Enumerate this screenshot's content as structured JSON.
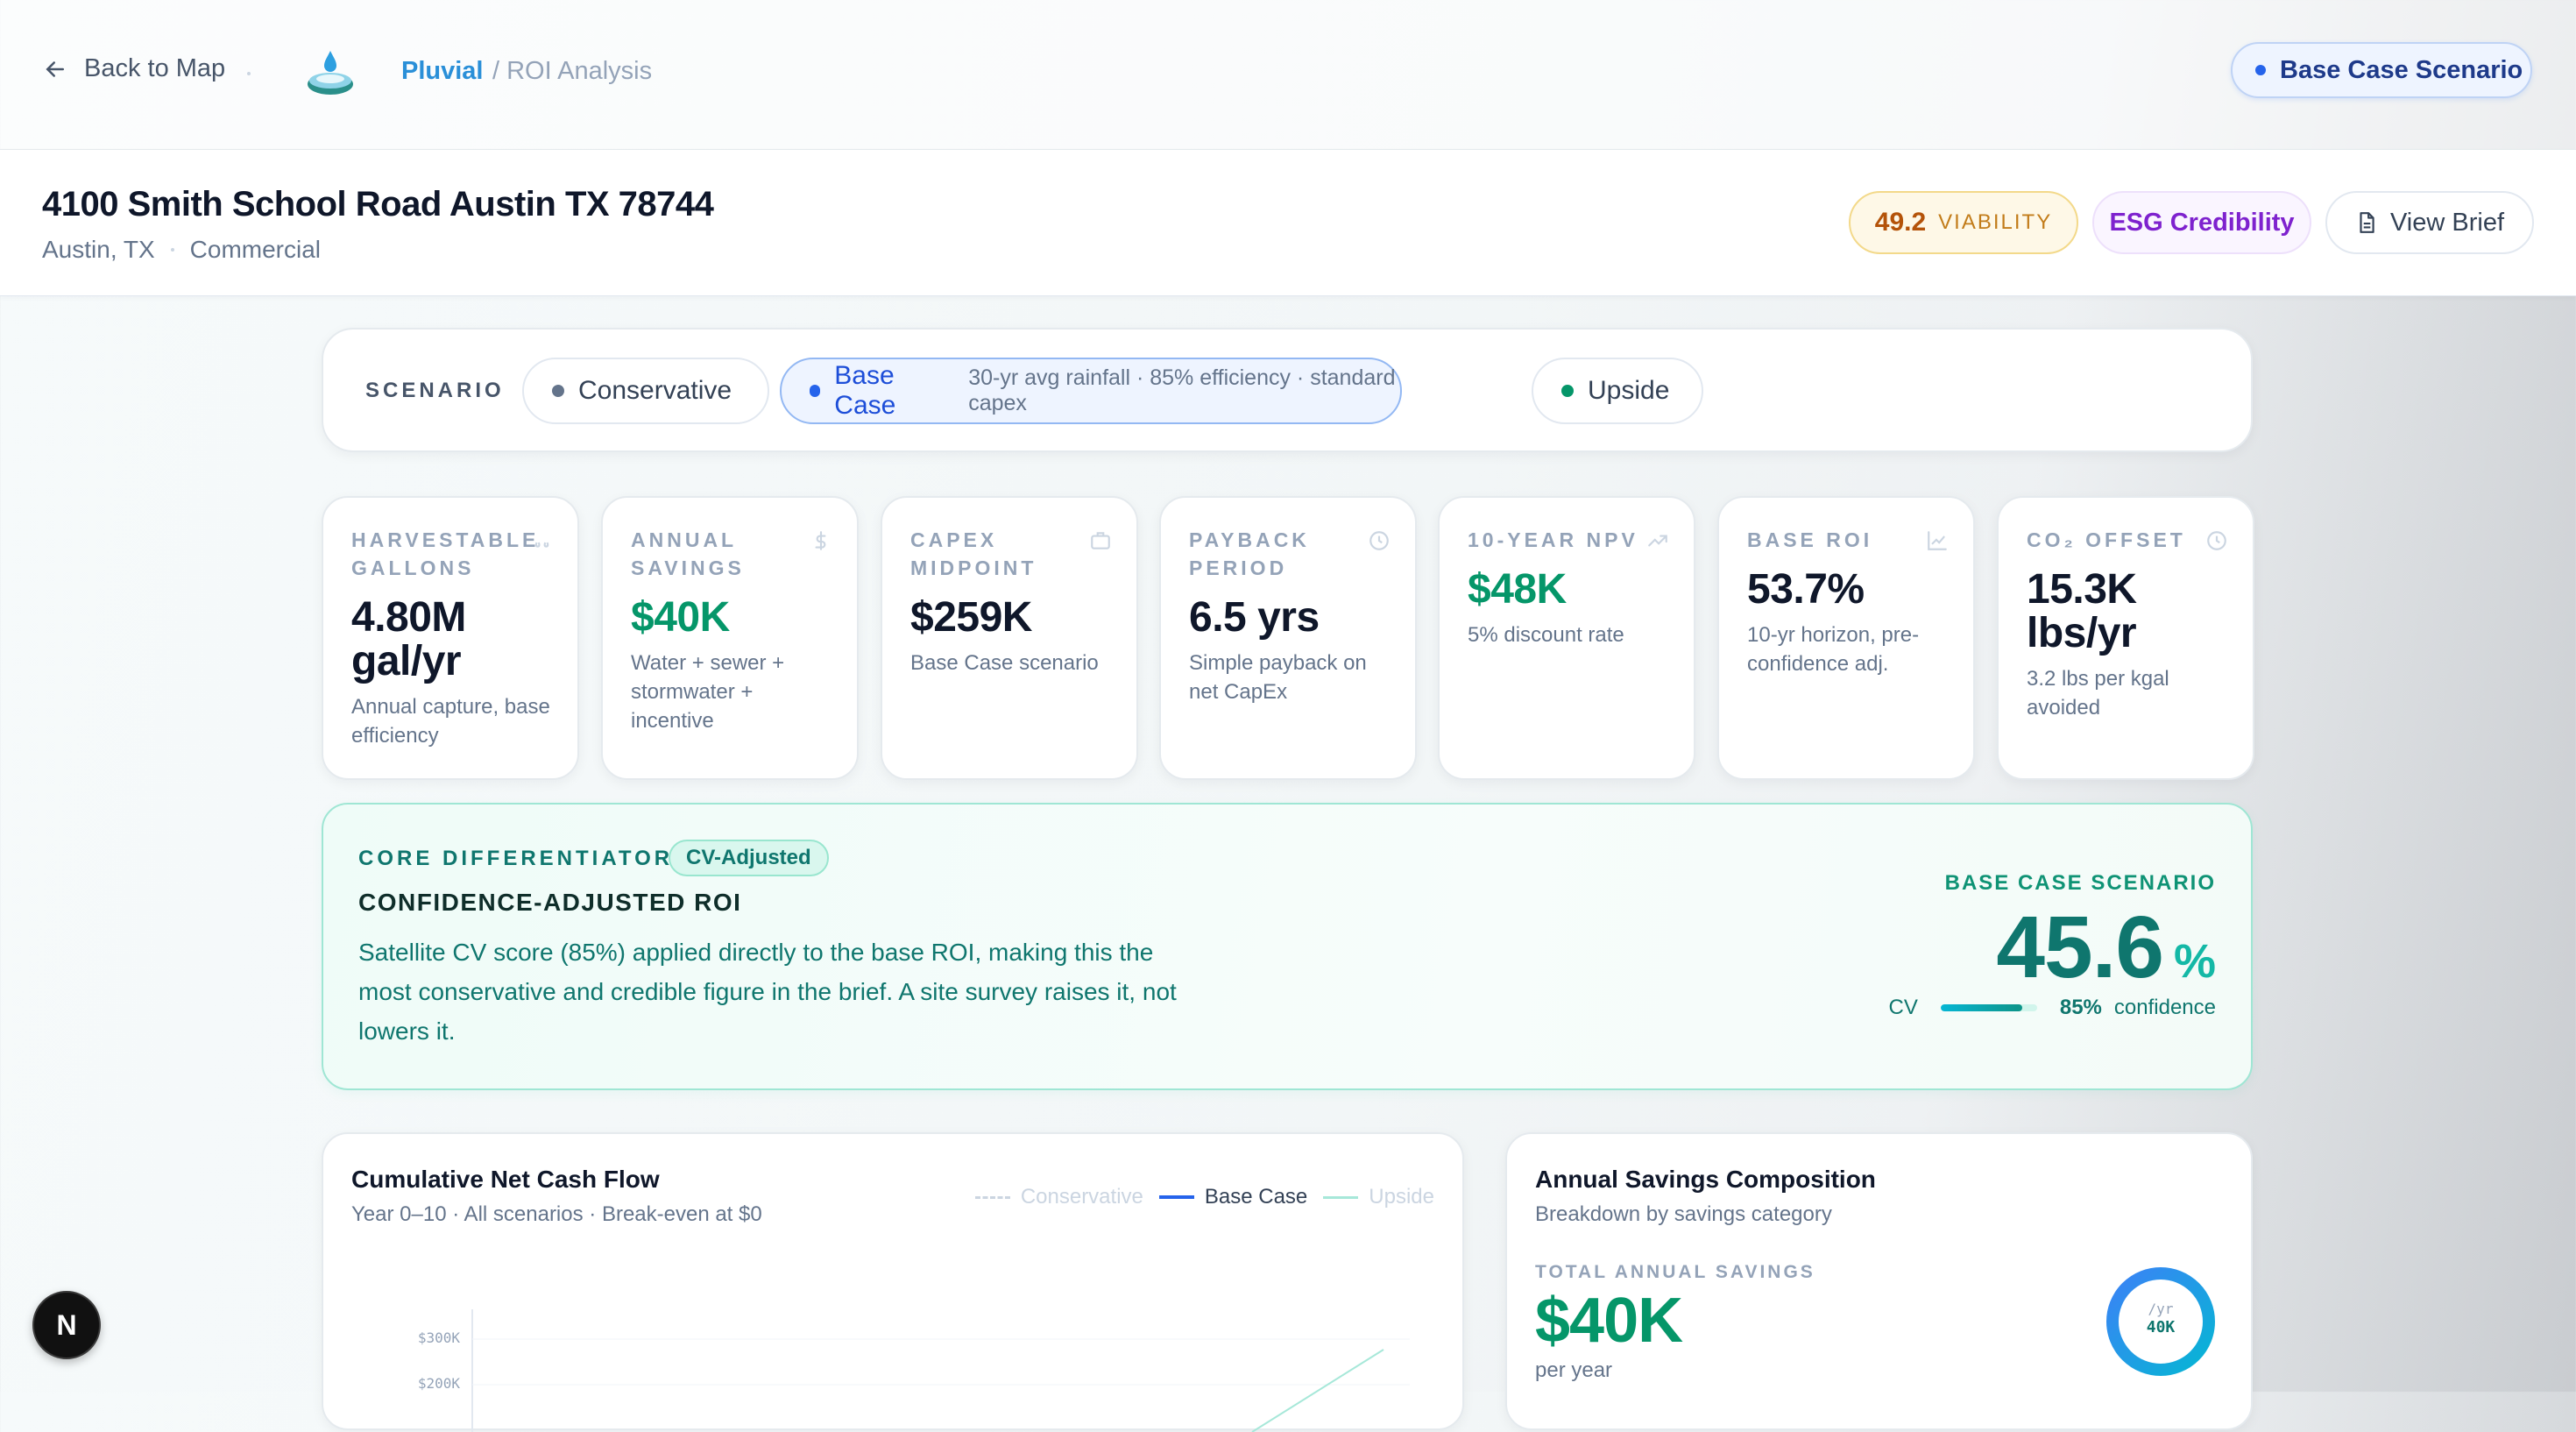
{
  "nav": {
    "back_label": "Back to Map",
    "brand": "Pluvial",
    "crumb": "/ ROI Analysis",
    "scenario_pill": "Base Case Scenario"
  },
  "property": {
    "address": "4100 Smith School Road Austin TX 78744",
    "city": "Austin, TX",
    "type": "Commercial",
    "viability_score": "49.2",
    "viability_label": "VIABILITY",
    "esg_label": "ESG Credibility",
    "brief_label": "View Brief"
  },
  "scenario": {
    "label": "SCENARIO",
    "options": [
      {
        "label": "Conservative",
        "desc": ""
      },
      {
        "label": "Base Case",
        "desc": "30-yr avg rainfall · 85% efficiency · standard capex"
      },
      {
        "label": "Upside",
        "desc": ""
      }
    ],
    "selected": "Base Case"
  },
  "kpis": [
    {
      "label": "HARVESTABLE GALLONS",
      "value": "4.80M gal/yr",
      "note": "Annual capture, base efficiency",
      "icon": "droplets-icon"
    },
    {
      "label": "ANNUAL SAVINGS",
      "value": "$40K",
      "note": "Water + sewer + stormwater + incentive",
      "icon": "dollar-icon"
    },
    {
      "label": "CAPEX MIDPOINT",
      "value": "$259K",
      "note": "Base Case scenario",
      "icon": "briefcase-icon"
    },
    {
      "label": "PAYBACK PERIOD",
      "value": "6.5 yrs",
      "note": "Simple payback on net CapEx",
      "icon": "clock-icon"
    },
    {
      "label": "10-YEAR NPV",
      "value": "$48K",
      "note": "5% discount rate",
      "icon": "trending-up-icon"
    },
    {
      "label": "BASE ROI",
      "value": "53.7%",
      "note": "10-yr horizon, pre-confidence adj.",
      "icon": "bar-chart-icon"
    },
    {
      "label": "CO₂ OFFSET",
      "value": "15.3K lbs/yr",
      "note": "3.2 lbs per kgal avoided",
      "icon": "clock-icon"
    }
  ],
  "differentiator": {
    "kicker": "CORE DIFFERENTIATOR",
    "badge": "CV-Adjusted",
    "title": "CONFIDENCE-ADJUSTED ROI",
    "body": "Satellite CV score (85%) applied directly to the base ROI, making this the most conservative and credible figure in the brief. A site survey raises it, not lowers it.",
    "scenario_label": "BASE CASE SCENARIO",
    "roi": "45.6",
    "roi_unit": "%",
    "cv_label": "CV",
    "cv_value": "85%",
    "cv_fraction": 0.85,
    "cv_suffix": "confidence"
  },
  "cashflow": {
    "title": "Cumulative Net Cash Flow",
    "subtitle": "Year 0–10 · All scenarios · Break-even at $0",
    "legend": [
      {
        "name": "Conservative",
        "color": "#cbd5e1"
      },
      {
        "name": "Base Case",
        "color": "#2563eb"
      },
      {
        "name": "Upside",
        "color": "#a7e8d9"
      }
    ],
    "ticks": [
      "$300K",
      "$200K"
    ]
  },
  "savings": {
    "title": "Annual Savings Composition",
    "subtitle": "Breakdown by savings category",
    "total_label": "TOTAL ANNUAL SAVINGS",
    "total_value": "$40K",
    "total_unit": "per year",
    "ring_top": "/yr",
    "ring_value": "40K"
  },
  "fab_label": "N",
  "colors": {
    "accent": "#2563eb",
    "green": "#059669",
    "teal": "#0f766e"
  }
}
